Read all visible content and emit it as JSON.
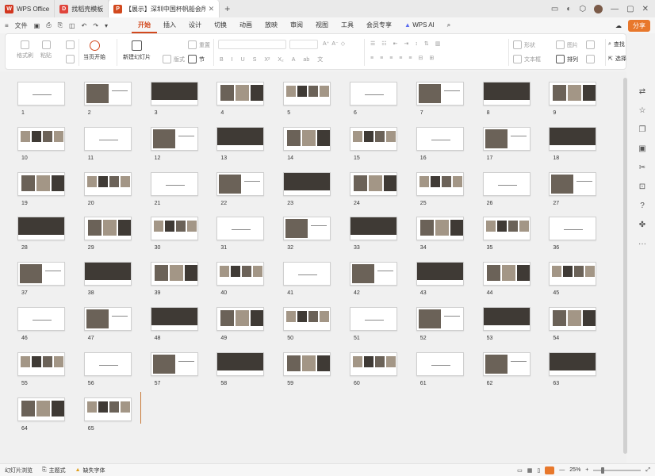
{
  "titlebar": {
    "tabs": [
      {
        "label": "WPS Office",
        "icon": "wps-logo-icon",
        "color": "#d2361f"
      },
      {
        "label": "找稻壳模板",
        "icon": "daoke-logo-icon",
        "color": "#e0443b"
      },
      {
        "label": "【展示】深圳中国杯帆船会所",
        "icon": "ppt-file-icon",
        "color": "#d2491e",
        "close": "✕"
      }
    ],
    "new_tab": "+",
    "user_initial": ""
  },
  "menubar": {
    "file_label": "文件",
    "items": [
      "开始",
      "插入",
      "设计",
      "切换",
      "动画",
      "放映",
      "审阅",
      "视图",
      "工具",
      "会员专享"
    ],
    "active": "开始",
    "ai_label": "WPS AI",
    "share_label": "分享"
  },
  "ribbon": {
    "format_painter": "格式刷",
    "paste": "粘贴",
    "play_from_current": "当页开始",
    "new_slide": "新建幻灯片",
    "layout": "版式",
    "reset": "重置",
    "section": "节",
    "shape": "形状",
    "image": "图片",
    "textbox": "文本框",
    "arrange": "排列",
    "find": "查找",
    "select": "选择"
  },
  "slides": [
    {
      "n": "1"
    },
    {
      "n": "2"
    },
    {
      "n": "3"
    },
    {
      "n": "4"
    },
    {
      "n": "5"
    },
    {
      "n": "6"
    },
    {
      "n": "7"
    },
    {
      "n": "8"
    },
    {
      "n": "9"
    },
    {
      "n": "10"
    },
    {
      "n": "11"
    },
    {
      "n": "12"
    },
    {
      "n": "13"
    },
    {
      "n": "14"
    },
    {
      "n": "15"
    },
    {
      "n": "16"
    },
    {
      "n": "17"
    },
    {
      "n": "18"
    },
    {
      "n": "19"
    },
    {
      "n": "20"
    },
    {
      "n": "21"
    },
    {
      "n": "22"
    },
    {
      "n": "23"
    },
    {
      "n": "24"
    },
    {
      "n": "25"
    },
    {
      "n": "26"
    },
    {
      "n": "27"
    },
    {
      "n": "28"
    },
    {
      "n": "29"
    },
    {
      "n": "30"
    },
    {
      "n": "31"
    },
    {
      "n": "32"
    },
    {
      "n": "33"
    },
    {
      "n": "34"
    },
    {
      "n": "35"
    },
    {
      "n": "36"
    },
    {
      "n": "37"
    },
    {
      "n": "38"
    },
    {
      "n": "39"
    },
    {
      "n": "40"
    },
    {
      "n": "41"
    },
    {
      "n": "42"
    },
    {
      "n": "43"
    },
    {
      "n": "44"
    },
    {
      "n": "45"
    },
    {
      "n": "46"
    },
    {
      "n": "47"
    },
    {
      "n": "48"
    },
    {
      "n": "49"
    },
    {
      "n": "50"
    },
    {
      "n": "51"
    },
    {
      "n": "52"
    },
    {
      "n": "53"
    },
    {
      "n": "54"
    },
    {
      "n": "55"
    },
    {
      "n": "56"
    },
    {
      "n": "57"
    },
    {
      "n": "58"
    },
    {
      "n": "59"
    },
    {
      "n": "60"
    },
    {
      "n": "61"
    },
    {
      "n": "62"
    },
    {
      "n": "63"
    },
    {
      "n": "64"
    },
    {
      "n": "65"
    }
  ],
  "statusbar": {
    "view_mode": "幻灯片浏览",
    "theme": "主题式",
    "missing_font": "缺失字体",
    "zoom": "25%"
  }
}
